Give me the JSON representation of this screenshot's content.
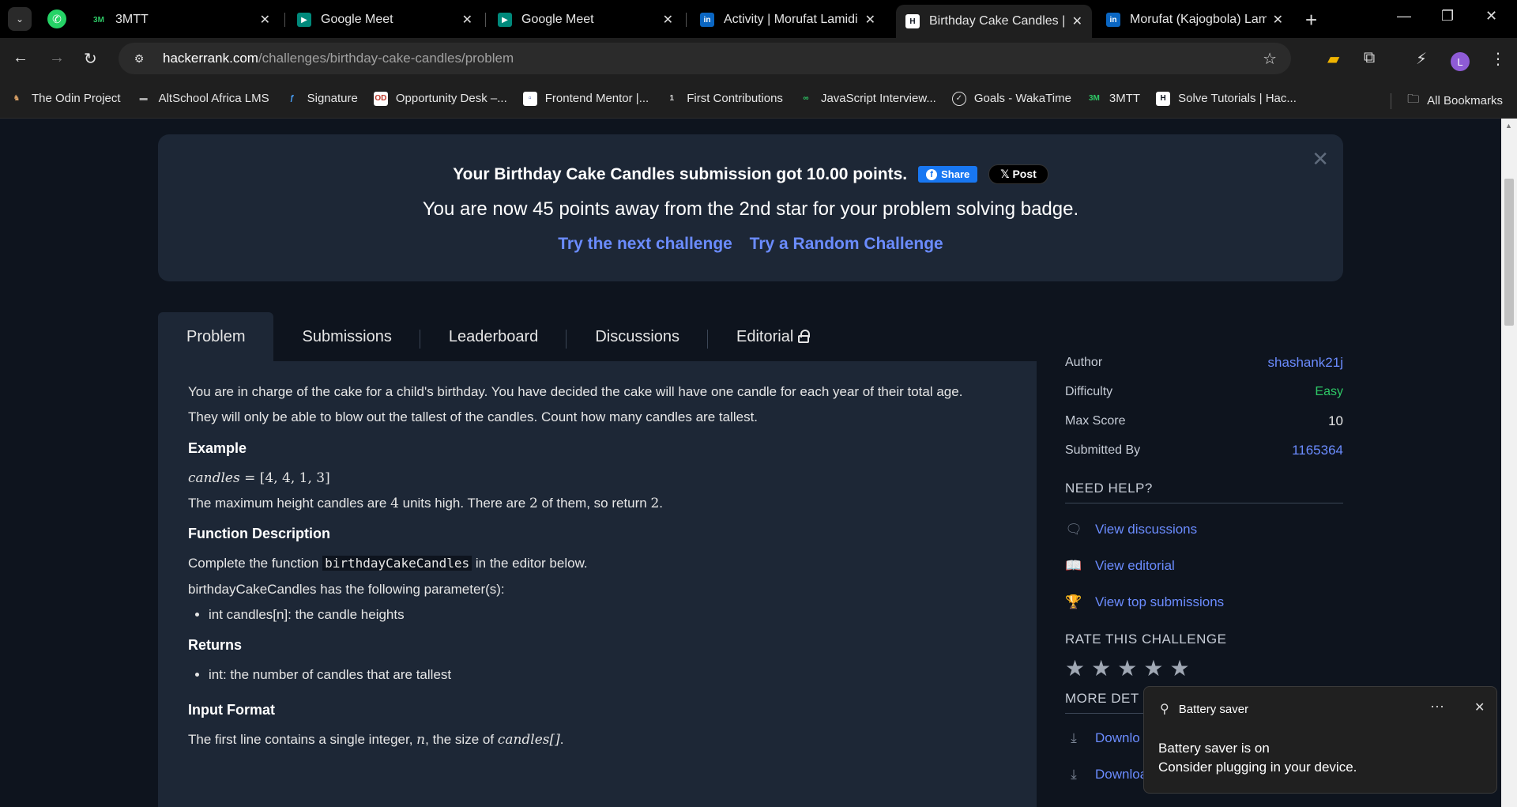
{
  "browser": {
    "tabs": [
      {
        "title": "3MTT",
        "favicon": "3mtt-favicon",
        "active": false
      },
      {
        "title": "Google Meet",
        "favicon": "google-meet-favicon",
        "active": false
      },
      {
        "title": "Google Meet",
        "favicon": "google-meet-favicon",
        "active": false
      },
      {
        "title": "Activity | Morufat Lamidi |",
        "favicon": "linkedin-favicon",
        "active": false
      },
      {
        "title": "Birthday Cake Candles | H",
        "favicon": "hackerrank-favicon",
        "active": true
      },
      {
        "title": "Morufat (Kajogbola) Lami",
        "favicon": "linkedin-favicon",
        "active": false
      }
    ],
    "url_host": "hackerrank.com",
    "url_path": "/challenges/birthday-cake-candles/problem",
    "avatar_letter": "L",
    "bookmarks": [
      "The Odin Project",
      "AltSchool Africa LMS",
      "Signature",
      "Opportunity Desk –...",
      "Frontend Mentor |...",
      "First Contributions",
      "JavaScript Interview...",
      "Goals - WakaTime",
      "3MTT",
      "Solve Tutorials | Hac..."
    ],
    "all_bookmarks": "All Bookmarks"
  },
  "banner": {
    "submission_text": "Your Birthday Cake Candles submission got 10.00 points.",
    "share_label": "Share",
    "post_label": "Post",
    "badge_text": "You are now 45 points away from the 2nd star for your problem solving badge.",
    "next_challenge": "Try the next challenge",
    "random_challenge": "Try a Random Challenge"
  },
  "tabs": [
    "Problem",
    "Submissions",
    "Leaderboard",
    "Discussions",
    "Editorial"
  ],
  "problem": {
    "intro_1": "You are in charge of the cake for a child's birthday. You have decided the cake will have one candle for each year of their total age.",
    "intro_2": "They will only be able to blow out the tallest of the candles. Count how many candles are tallest.",
    "example_heading": "Example",
    "example_var": "candles",
    "example_eq": " = [4, 4, 1, 3]",
    "example_expl_a": "The maximum height candles are ",
    "example_expl_num1": "4",
    "example_expl_b": " units high. There are ",
    "example_expl_num2": "2",
    "example_expl_c": " of them, so return ",
    "example_expl_num3": "2",
    "example_expl_d": ".",
    "function_heading": "Function Description",
    "function_text_a": "Complete the function ",
    "function_name": "birthdayCakeCandles",
    "function_text_b": " in the editor below.",
    "params_text": "birthdayCakeCandles has the following parameter(s):",
    "param_1": "int candles[n]: the candle heights",
    "returns_heading": "Returns",
    "return_1": "int: the number of candles that are tallest",
    "input_heading": "Input Format",
    "input_text_a": "The first line contains a single integer, ",
    "input_var_n": "n",
    "input_text_b": ", the size of ",
    "input_var_candles": "candles[]",
    "input_text_c": "."
  },
  "sidebar": {
    "author_label": "Author",
    "author_value": "shashank21j",
    "difficulty_label": "Difficulty",
    "difficulty_value": "Easy",
    "max_score_label": "Max Score",
    "max_score_value": "10",
    "submitted_by_label": "Submitted By",
    "submitted_by_value": "1165364",
    "need_help": "NEED HELP?",
    "view_discussions": "View discussions",
    "view_editorial": "View editorial",
    "view_top_submissions": "View top submissions",
    "rate_heading": "RATE THIS CHALLENGE",
    "rating_stars": 5,
    "more_details": "MORE DET",
    "download_1": "Downlo",
    "download_2": "Download sample test cases"
  },
  "toast": {
    "title": "Battery saver",
    "line1": "Battery saver is on",
    "line2": "Consider plugging in your device."
  },
  "colors": {
    "page_bg": "#0e141e",
    "panel_bg": "#1d2736",
    "link": "#6b8cff",
    "easy": "#2ec866"
  }
}
